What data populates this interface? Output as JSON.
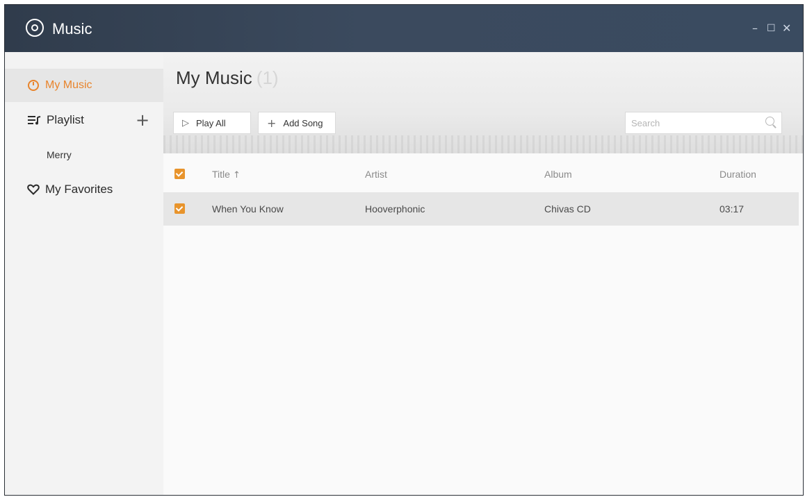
{
  "window": {
    "title": "Music",
    "controls": {
      "minimize": "–",
      "maximize": "☐",
      "close": "✕"
    }
  },
  "sidebar": {
    "items": [
      {
        "label": "My Music",
        "icon": "music-disc-icon",
        "active": true
      },
      {
        "label": "Playlist",
        "icon": "playlist-icon",
        "add_label": "+"
      },
      {
        "label": "My Favorites",
        "icon": "heart-icon"
      }
    ],
    "playlists": [
      {
        "label": "Merry"
      }
    ]
  },
  "main": {
    "title": "My Music",
    "count": "(1)",
    "toolbar": {
      "play_all": "Play All",
      "play_icon": "▷",
      "add_song": "Add Song",
      "add_icon": "+"
    },
    "search": {
      "placeholder": "Search",
      "value": ""
    },
    "table": {
      "columns": [
        "Title",
        "Artist",
        "Album",
        "Duration"
      ],
      "sort_icon": "↑",
      "rows": [
        {
          "title": "When You Know",
          "artist": "Hooverphonic",
          "album": "Chivas CD",
          "duration": "03:17",
          "checked": true
        }
      ]
    }
  },
  "colors": {
    "accent": "#e8842c",
    "titlebar": "#35465a",
    "selected_row": "#e6e6e6"
  }
}
